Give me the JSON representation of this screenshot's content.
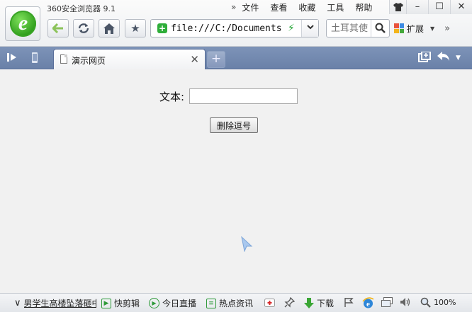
{
  "app": {
    "title": "360安全浏览器 9.1"
  },
  "menu": {
    "items": [
      "文件",
      "查看",
      "收藏",
      "工具",
      "帮助"
    ]
  },
  "address": {
    "url": "file:///C:/Documents"
  },
  "search": {
    "placeholder": "土耳其使"
  },
  "extensions": {
    "label": "扩展"
  },
  "tab": {
    "title": "演示网页"
  },
  "page": {
    "label": "文本:",
    "input_value": "",
    "button_label": "删除逗号"
  },
  "status": {
    "news": "男学生高楼坠落砸中",
    "clip": "快剪辑",
    "live": "今日直播",
    "hot": "热点资讯",
    "download": "下载",
    "zoom": "100%"
  },
  "colors": {
    "tabstrip": "#7489af",
    "accent_green": "#2fae3a",
    "back_arrow": "#7fbf4f"
  }
}
